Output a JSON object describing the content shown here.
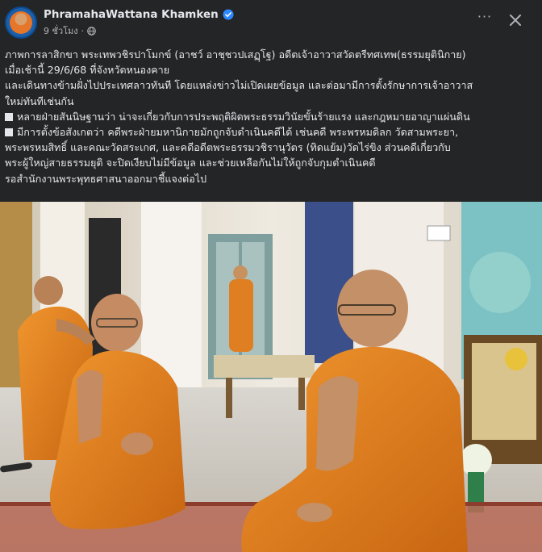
{
  "post": {
    "page_name": "PhramahaWattana Khamken",
    "time_ago": "9 ชั่วโมง",
    "separator": "·",
    "more_label": "···"
  },
  "caption": {
    "lines": [
      "ภาพการลาสิกขา พระเทพวชิรปาโมกข์ (อาชว์ อาชฺชวปเสฏฺโฐ) อดีตเจ้าอาวาสวัดตรีทศเทพ(ธรรมยุตินิกาย)",
      "เมื่อเช้านี้ 29/6/68 ที่จังหวัดหนองคาย",
      "และเดินทางข้ามฝั่งไปประเทศลาวทันที โดยแหล่งข่าวไม่เปิดเผยข้อมูล และต่อมามีการตั้งรักษาการเจ้าอาวาส",
      "ใหม่ทันทีเช่นกัน",
      "หลายฝ่ายสันนิษฐานว่า น่าจะเกี่ยวกับการประพฤติผิดพระธรรมวินัยขั้นร้ายแรง และกฎหมายอาญาแผ่นดิน",
      "มีการตั้งข้อสังเกตว่า คดีพระฝ่ายมหานิกายมักถูกจับดำเนินคดีได้ เช่นคดี พระพรหมดิลก วัดสามพระยา,",
      "พระพรหมสิทธิ์ และคณะวัดสระเกศ, และคดีอดีตพระธรรมวชิรานุวัตร (ทิดแย้ม)วัดไร่ขิง ส่วนคดีเกี่ยวกับ",
      "พระผู้ใหญ่สายธรรมยุติ จะปิดเงียบไม่มีข้อมูล และช่วยเหลือกันไม่ให้ถูกจับกุมดำเนินคดี",
      "รอสำนักงานพระพุทธศาสนาออกมาชี้แจงต่อไป"
    ]
  },
  "colors": {
    "background": "#242526",
    "text": "#e4e6eb",
    "secondary_text": "#b0b3b8",
    "verified": "#2d88ff",
    "robe": "#e07f22"
  },
  "icons": {
    "verified": "verified-badge-icon",
    "globe": "globe-icon",
    "more": "more-options-icon",
    "close": "close-icon"
  }
}
